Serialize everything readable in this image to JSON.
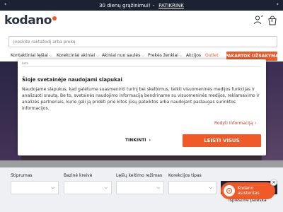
{
  "promo": {
    "text": "30 dienų grąžinimui!",
    "separator": "-",
    "link": "PATIKRINK",
    "prev_icon": "chevron-left-icon",
    "next_icon": "chevron-right-icon"
  },
  "header": {
    "logo": "kodano",
    "user_icon": "user-icon",
    "cart_icon": "shopping-bag-icon",
    "cart_count": "0"
  },
  "search": {
    "placeholder": "Įveskite raktažodį arba prekę"
  },
  "nav": {
    "items": [
      {
        "label": "Kontaktiniai lęšiai",
        "has_menu": true
      },
      {
        "label": "Korekciniai akiniai",
        "has_menu": true
      },
      {
        "label": "Akiniai nuo saulės",
        "has_menu": true
      },
      {
        "label": "Prekės ženklai",
        "has_menu": true
      },
      {
        "label": "Akcijos",
        "has_menu": false
      },
      {
        "label": "Outlet",
        "has_menu": false
      }
    ],
    "cta": "PAKARTOK UŽSAKYMĄ",
    "accent_color": "#f05a28"
  },
  "cookie": {
    "tag": "beta",
    "title": "Šioje svetainėje naudojami slapukai",
    "body": "Naudojame slapukus, kad galėtume suasmeninti turinį bei skelbimus, teikti visuomeninės medijos funkcijas ir analizuoti srautą. Be to, svetainės naudojimo informaciją bendriname su visuomeninės medijos, reklamavimo ir analizės partneriais, kurie gali ją pridėti prie kitos jūsų pateiktos arba naudojant paslaugas surinktos informacijos.",
    "details_link": "Rodyti informaciją",
    "customize_button": "TINKINTI",
    "accept_button": "LEISTI VISUS"
  },
  "filters": {
    "fields": [
      {
        "label": "Stiprumas"
      },
      {
        "label": "Bazinė kreivė"
      },
      {
        "label": "Lęšių keitimo režimas"
      },
      {
        "label": "Korekcijos tipas"
      }
    ],
    "advanced_search": "Išplėstinė paieška"
  },
  "assistant": {
    "line1": "Kodano",
    "line2": "asistentas",
    "close": "×"
  }
}
